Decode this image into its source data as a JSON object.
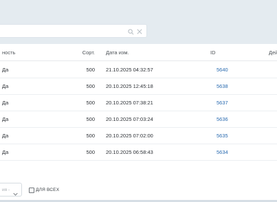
{
  "search": {
    "value": "",
    "placeholder": "",
    "search_icon": "search-icon",
    "clear_icon": "close-icon"
  },
  "table": {
    "headers": {
      "active": "ность",
      "sort": "Сорт.",
      "date": "Дата изм.",
      "id": "ID",
      "extra": "Дей"
    },
    "rows": [
      {
        "active": "Да",
        "sort": "500",
        "date": "21.10.2025 04:32:57",
        "id": "5640"
      },
      {
        "active": "Да",
        "sort": "500",
        "date": "20.10.2025 12:45:18",
        "id": "5638"
      },
      {
        "active": "Да",
        "sort": "500",
        "date": "20.10.2025 07:38:21",
        "id": "5637"
      },
      {
        "active": "Да",
        "sort": "500",
        "date": "20.10.2025 07:03:24",
        "id": "5636"
      },
      {
        "active": "Да",
        "sort": "500",
        "date": "20.10.2025 07:02:00",
        "id": "5635"
      },
      {
        "active": "Да",
        "sort": "500",
        "date": "20.10.2025 06:58:43",
        "id": "5634"
      }
    ]
  },
  "footer": {
    "select_value": "ия -",
    "checkbox_label": "ДЛЯ ВСЕХ"
  },
  "colors": {
    "background": "#e4ebf0",
    "link": "#2a6bb0"
  }
}
